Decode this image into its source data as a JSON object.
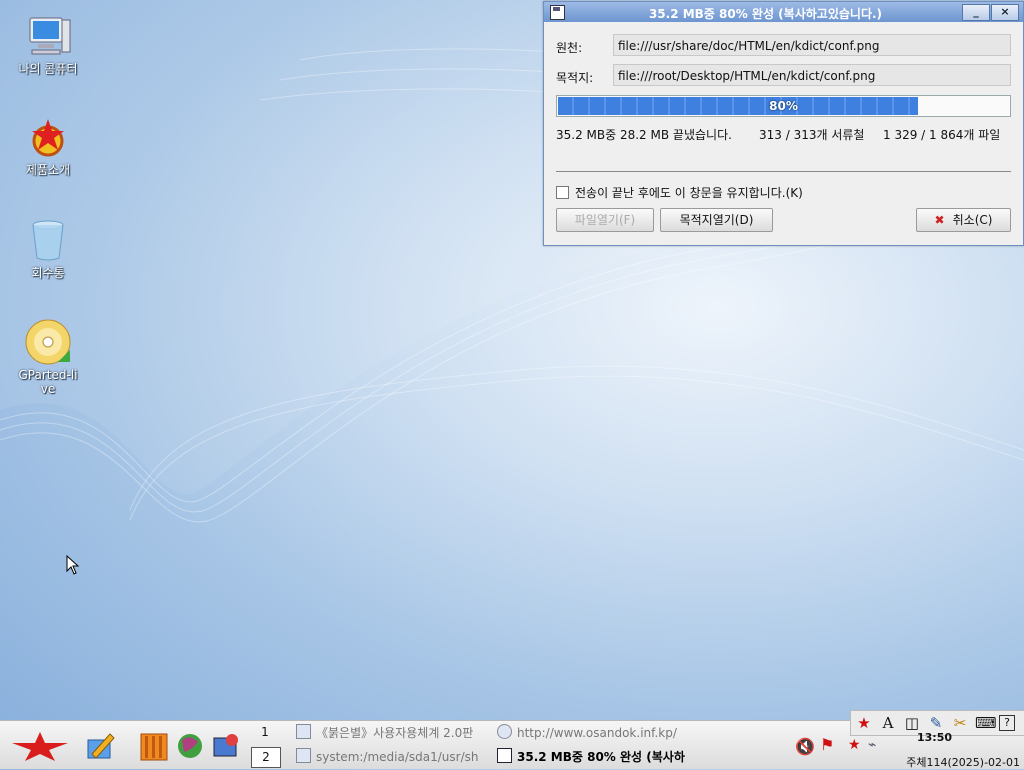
{
  "desktop": {
    "icons": [
      {
        "label": "나의 콤퓨터",
        "icon": "computer-icon"
      },
      {
        "label": "제품소개",
        "icon": "product-intro-icon"
      },
      {
        "label": "회수통",
        "icon": "trash-icon"
      },
      {
        "label": "GParted-live",
        "icon": "gparted-disc-icon"
      }
    ]
  },
  "dialog": {
    "title": "35.2 MB중 80% 완성 (복사하고있습니다.)",
    "minimize": "_",
    "close": "×",
    "source_label": "원천:",
    "source_value": "file:///usr/share/doc/HTML/en/kdict/conf.png",
    "dest_label": "목적지:",
    "dest_value": "file:///root/Desktop/HTML/en/kdict/conf.png",
    "progress_percent": 80,
    "progress_text": "80%",
    "bytes_text": "35.2 MB중 28.2 MB 끝냈습니다.",
    "dirs_text": "313 / 313개 서류철",
    "files_text": "1 329 / 1 864개 파일",
    "keep_open_label": "전송이 끝난 후에도 이 창문을 유지합니다.(K)",
    "keep_open_checked": false,
    "open_file_button": "파일열기(F)",
    "open_dest_button": "목적지열기(D)",
    "cancel_button": "취소(C)"
  },
  "taskbar": {
    "pager": [
      "1",
      "2"
    ],
    "tasks": [
      {
        "label": "《붉은별》사용자용체계 2.0판",
        "active": false
      },
      {
        "label": "http://www.osandok.inf.kp/",
        "active": false
      },
      {
        "label": "system:/media/sda1/usr/sh",
        "active": false
      },
      {
        "label": "35.2 MB중 80% 완성 (복사하",
        "active": true
      }
    ],
    "clock": "13:50",
    "date": "주체114(2025)-02-01"
  }
}
